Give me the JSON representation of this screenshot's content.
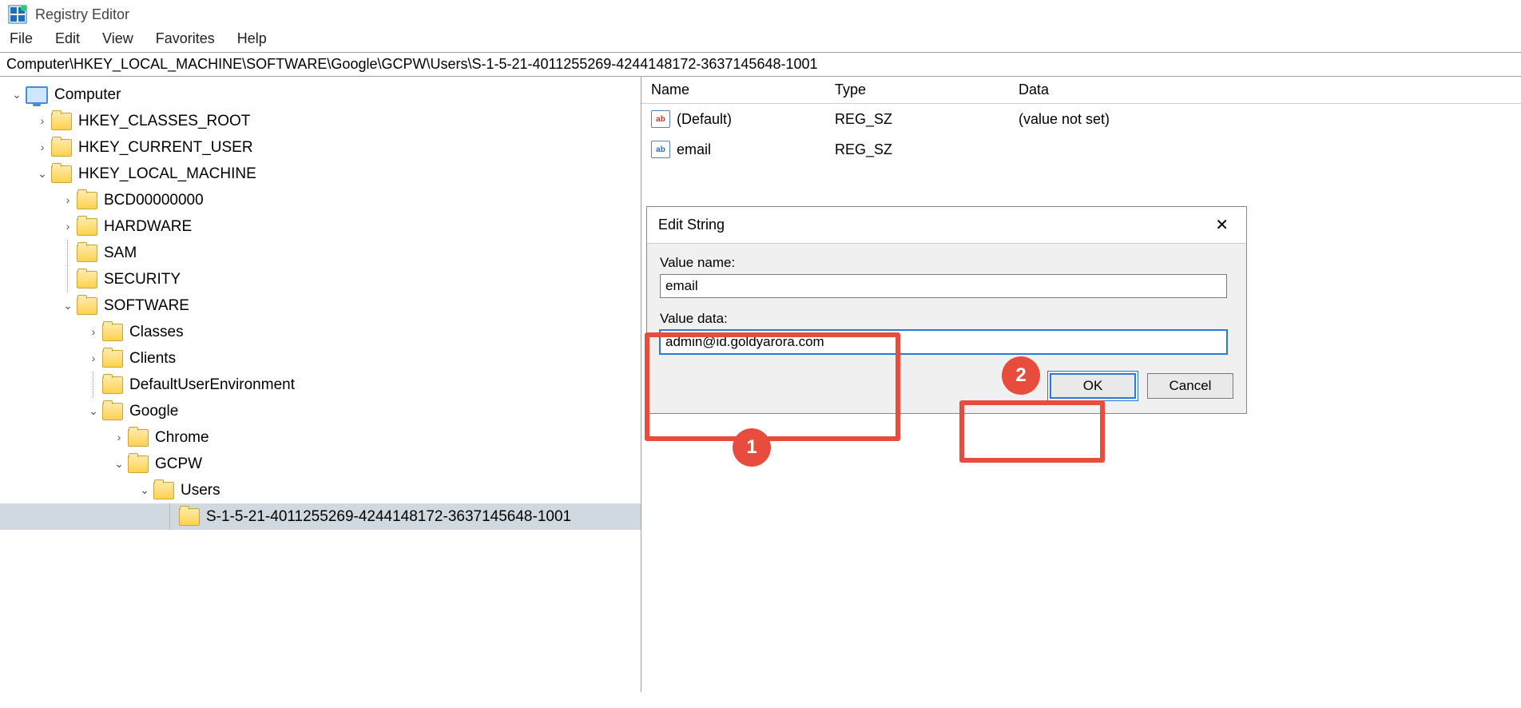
{
  "app": {
    "title": "Registry Editor"
  },
  "menu": {
    "file": "File",
    "edit": "Edit",
    "view": "View",
    "favorites": "Favorites",
    "help": "Help"
  },
  "address": "Computer\\HKEY_LOCAL_MACHINE\\SOFTWARE\\Google\\GCPW\\Users\\S-1-5-21-4011255269-4244148172-3637145648-1001",
  "tree": {
    "root": "Computer",
    "hkcr": "HKEY_CLASSES_ROOT",
    "hkcu": "HKEY_CURRENT_USER",
    "hklm": "HKEY_LOCAL_MACHINE",
    "bcd": "BCD00000000",
    "hardware": "HARDWARE",
    "sam": "SAM",
    "security": "SECURITY",
    "software": "SOFTWARE",
    "classes": "Classes",
    "clients": "Clients",
    "due": "DefaultUserEnvironment",
    "google": "Google",
    "chrome": "Chrome",
    "gcpw": "GCPW",
    "users": "Users",
    "sid": "S-1-5-21-4011255269-4244148172-3637145648-1001"
  },
  "cols": {
    "name": "Name",
    "type": "Type",
    "data": "Data"
  },
  "rows": [
    {
      "name": "(Default)",
      "type": "REG_SZ",
      "data": "(value not set)"
    },
    {
      "name": "email",
      "type": "REG_SZ",
      "data": ""
    }
  ],
  "dlg": {
    "title": "Edit String",
    "value_name_label": "Value name:",
    "value_name": "email",
    "value_data_label": "Value data:",
    "value_data": "admin@id.goldyarora.com",
    "ok": "OK",
    "cancel": "Cancel"
  },
  "annotations": {
    "one": "1",
    "two": "2"
  }
}
